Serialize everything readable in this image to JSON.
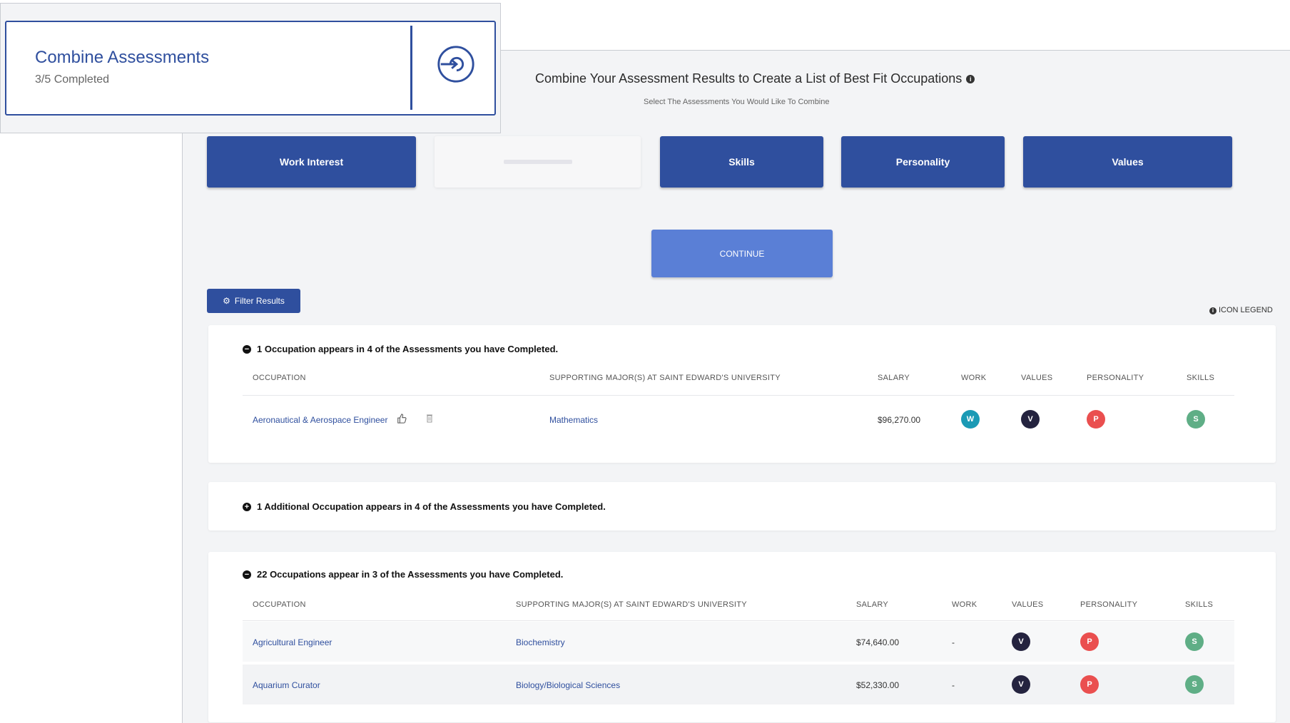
{
  "overlay": {
    "title": "Combine Assessments",
    "progress": "3/5 Completed"
  },
  "main": {
    "title": "Combine Your Assessment Results to Create a List of Best Fit Occupations",
    "subtitle": "Select The Assessments You Would Like To Combine",
    "assessments": [
      {
        "label": "Work Interest",
        "selected": true
      },
      {
        "label": "",
        "selected": false
      },
      {
        "label": "Skills",
        "selected": true
      },
      {
        "label": "Personality",
        "selected": true
      },
      {
        "label": "Values",
        "selected": true
      }
    ],
    "continue_label": "CONTINUE",
    "filter_label": "Filter Results",
    "icon_legend_label": "ICON LEGEND"
  },
  "groups": [
    {
      "heading": "1 Occupation appears in 4 of the Assessments you have Completed.",
      "toggle": "−",
      "columns": [
        "OCCUPATION",
        "SUPPORTING MAJOR(S) AT SAINT EDWARD'S UNIVERSITY",
        "SALARY",
        "WORK",
        "VALUES",
        "PERSONALITY",
        "SKILLS"
      ],
      "rows": [
        {
          "occupation": "Aeronautical & Aerospace Engineer",
          "major": "Mathematics",
          "salary": "$96,270.00",
          "work": "W",
          "values": "V",
          "personality": "P",
          "skills": "S"
        }
      ]
    },
    {
      "heading": "1 Additional Occupation appears in 4 of the Assessments you have Completed.",
      "toggle": "+"
    },
    {
      "heading": "22 Occupations appear in 3 of the Assessments you have Completed.",
      "toggle": "−",
      "columns": [
        "OCCUPATION",
        "SUPPORTING MAJOR(S) AT SAINT EDWARD'S UNIVERSITY",
        "SALARY",
        "WORK",
        "VALUES",
        "PERSONALITY",
        "SKILLS"
      ],
      "rows": [
        {
          "occupation": "Agricultural Engineer",
          "major": "Biochemistry",
          "salary": "$74,640.00",
          "work": "-",
          "values": "V",
          "personality": "P",
          "skills": "S"
        },
        {
          "occupation": "Aquarium Curator",
          "major": "Biology/Biological Sciences",
          "salary": "$52,330.00",
          "work": "-",
          "values": "V",
          "personality": "P",
          "skills": "S"
        }
      ]
    }
  ],
  "colors": {
    "primary": "#2f4f9e",
    "continue": "#5a7fd6",
    "work_badge": "#1b9ab5",
    "values_badge": "#24233f",
    "personality_badge": "#ea4f4f",
    "skills_badge": "#5fae86"
  }
}
